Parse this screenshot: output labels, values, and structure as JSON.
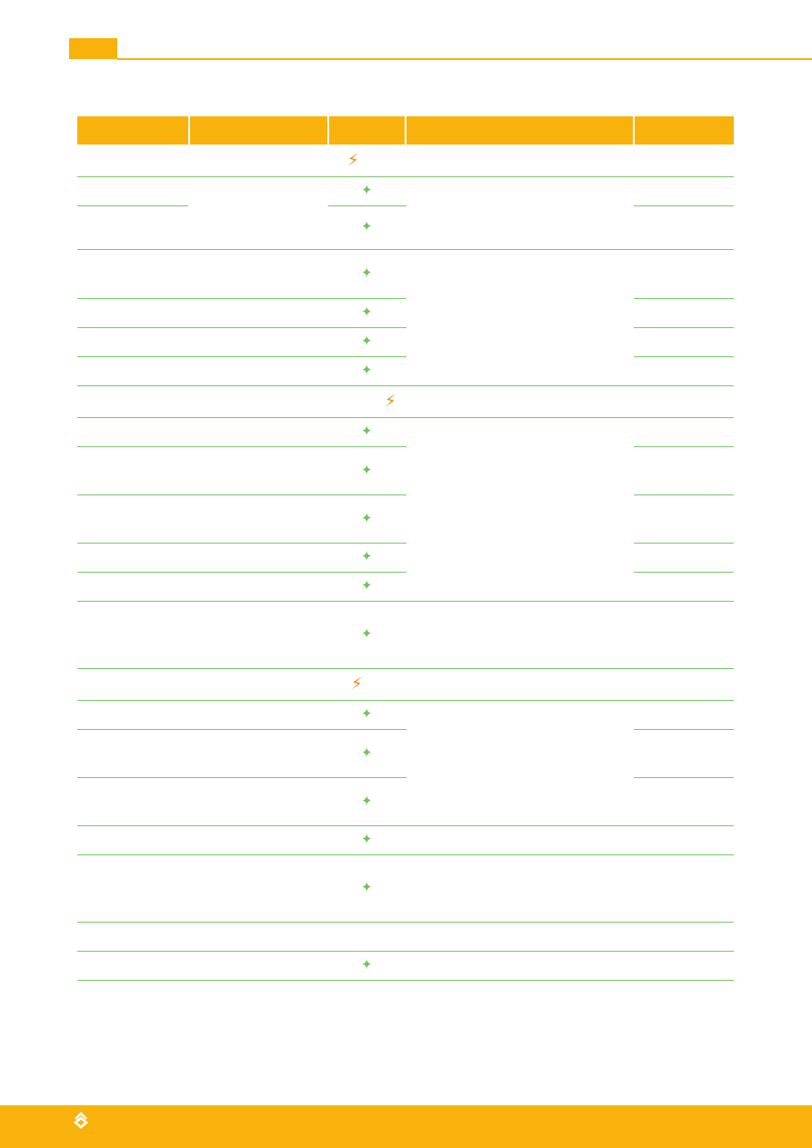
{
  "page": {
    "accent_color": "#f9b20c",
    "rule_color": "#7cc56e"
  },
  "header_row": [
    "",
    "",
    "",
    "",
    ""
  ],
  "icons": {
    "star": "green-four-point-star-icon",
    "bolt": "orange-lightning-bolt-icon",
    "logo": "brand-chevron-logo-icon"
  }
}
